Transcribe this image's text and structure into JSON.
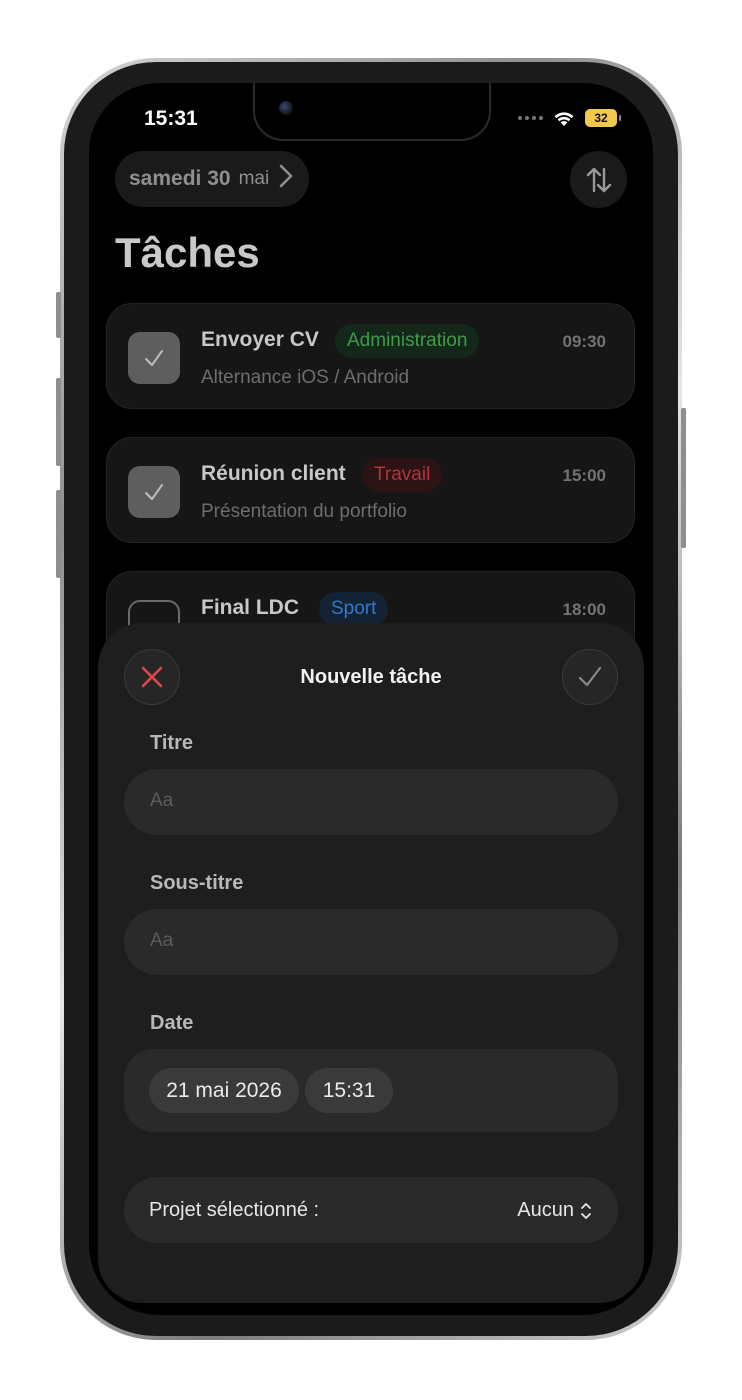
{
  "status_bar": {
    "time": "15:31",
    "battery": "32"
  },
  "header": {
    "date_day": "samedi 30",
    "date_month": "mai",
    "title": "Tâches"
  },
  "tasks": [
    {
      "title": "Envoyer CV",
      "tag": "Administration",
      "subtitle": "Alternance iOS / Android",
      "time": "09:30",
      "done": true
    },
    {
      "title": "Réunion client",
      "tag": "Travail",
      "subtitle": "Présentation du portfolio",
      "time": "15:00",
      "done": true
    },
    {
      "title": "Final LDC",
      "tag": "Sport",
      "subtitle": "",
      "time": "18:00",
      "done": false
    }
  ],
  "sheet": {
    "title": "Nouvelle tâche",
    "title_label": "Titre",
    "title_placeholder": "Aa",
    "subtitle_label": "Sous-titre",
    "subtitle_placeholder": "Aa",
    "date_label": "Date",
    "date_value": "21 mai 2026",
    "time_value": "15:31",
    "project_label": "Projet sélectionné :",
    "project_value": "Aucun"
  },
  "colors": {
    "tag_administration_text": "#3f9b4a",
    "tag_administration_bg": "#13281a",
    "tag_travail_text": "#b0353b",
    "tag_travail_bg": "#2c1416",
    "tag_sport_text": "#3479c5",
    "tag_sport_bg": "#142236",
    "cancel_icon": "#e0474c"
  }
}
